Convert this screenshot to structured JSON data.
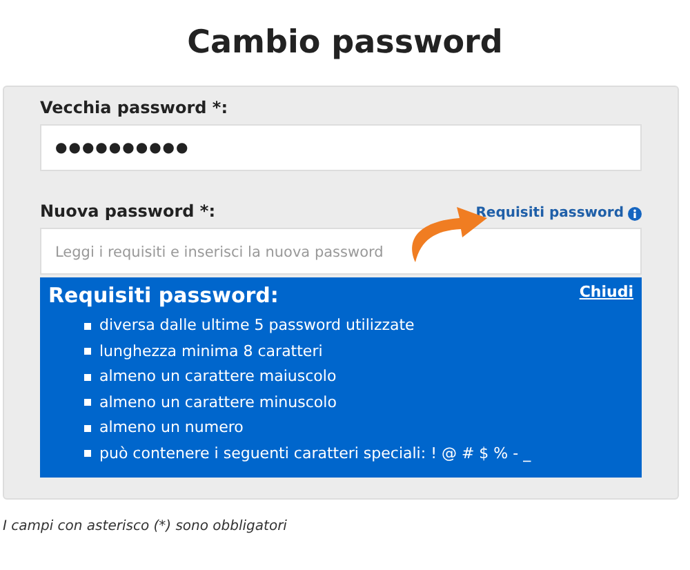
{
  "title": "Cambio password",
  "form": {
    "old_password": {
      "label": "Vecchia password *:",
      "value": "●●●●●●●●●●"
    },
    "new_password": {
      "label": "Nuova password *:",
      "placeholder": "Leggi i requisiti e inserisci la nuova password"
    },
    "requirements_link": "Requisiti password",
    "requirements_panel": {
      "title": "Requisiti password:",
      "close": "Chiudi",
      "items": [
        "diversa dalle ultime 5 password utilizzate",
        "lunghezza minima 8 caratteri",
        "almeno un carattere maiuscolo",
        "almeno un carattere minuscolo",
        "almeno un numero",
        "può contenere i seguenti caratteri speciali: ! @ # $ % - _"
      ]
    }
  },
  "footnote": "I campi con asterisco (*) sono obbligatori"
}
